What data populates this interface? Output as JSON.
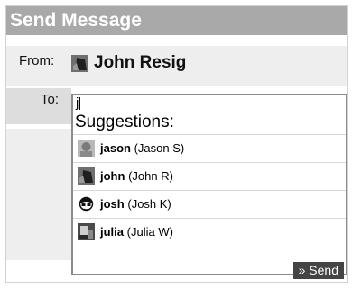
{
  "header": {
    "title": "Send Message"
  },
  "from": {
    "label": "From:",
    "name": "John Resig",
    "avatar_icon": "user-avatar-john"
  },
  "to": {
    "label": "To:",
    "input_value": "j",
    "suggestions_title": "Suggestions:",
    "suggestions": [
      {
        "username": "jason",
        "fullname": "(Jason S)",
        "avatar_icon": "user-avatar-jason"
      },
      {
        "username": "john",
        "fullname": "(John R)",
        "avatar_icon": "user-avatar-john"
      },
      {
        "username": "josh",
        "fullname": "(Josh K)",
        "avatar_icon": "user-avatar-josh"
      },
      {
        "username": "julia",
        "fullname": "(Julia W)",
        "avatar_icon": "user-avatar-julia"
      }
    ]
  },
  "actions": {
    "send_label": "» Send"
  },
  "colors": {
    "titlebar": "#a9a9a9",
    "button": "#444444",
    "row_bg": "#eeeeee"
  }
}
